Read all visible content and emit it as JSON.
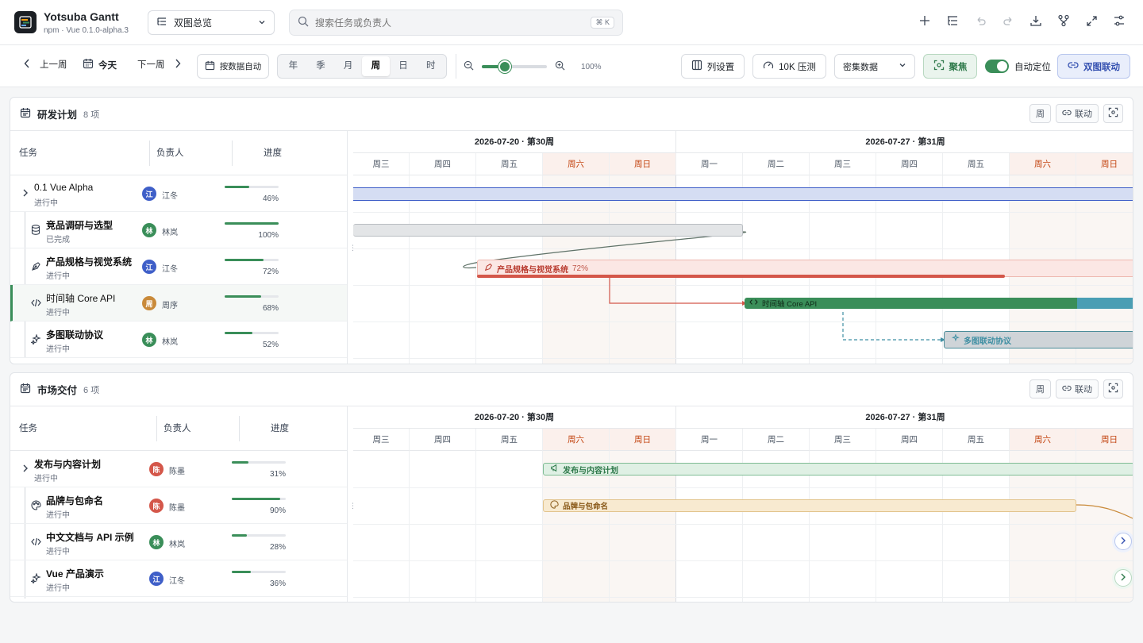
{
  "app": {
    "name": "Yotsuba Gantt",
    "version": "npm · Vue 0.1.0-alpha.3"
  },
  "view_select": {
    "label": "双图总览"
  },
  "search": {
    "placeholder": "搜索任务或负责人",
    "shortcut": "⌘ K"
  },
  "toolbar": {
    "prev_week": "上一周",
    "today": "今天",
    "next_week": "下一周",
    "auto_fit": "按数据自动",
    "scales": [
      "年",
      "季",
      "月",
      "周",
      "日",
      "时"
    ],
    "active_scale": "周",
    "zoom_value": "100%",
    "zoom_level": 0.35,
    "columns": "列设置",
    "stress": "10K 压测",
    "dataset": "密集数据",
    "focus": "聚焦",
    "auto_locate": "自动定位",
    "linked": "双图联动"
  },
  "panels": [
    {
      "title": "研发计划",
      "count": "8 项",
      "buttons": {
        "week": "周",
        "link": "联动"
      },
      "columns": {
        "task": "任务",
        "owner": "负责人",
        "progress": "进度"
      },
      "timeline": {
        "week1": "2026-07-20 · 第30周",
        "week2": "2026-07-27 · 第31周",
        "days": [
          "周三",
          "周四",
          "周五",
          "周六",
          "周日",
          "周一",
          "周二",
          "周三",
          "周四",
          "周五",
          "周六",
          "周日"
        ]
      },
      "rows": [
        {
          "name": "0.1 Vue Alpha",
          "status": "进行中",
          "owner": "江冬",
          "avatar": "江",
          "progress": "46%",
          "pct": 46
        },
        {
          "name": "竞品调研与选型",
          "status": "已完成",
          "owner": "林岚",
          "avatar": "林",
          "progress": "100%",
          "pct": 100
        },
        {
          "name": "产品规格与视觉系统",
          "status": "进行中",
          "owner": "江冬",
          "avatar": "江",
          "progress": "72%",
          "pct": 72
        },
        {
          "name": "时间轴 Core API",
          "status": "进行中",
          "owner": "周序",
          "avatar": "周",
          "progress": "68%",
          "pct": 68
        },
        {
          "name": "多图联动协议",
          "status": "进行中",
          "owner": "林岚",
          "avatar": "林",
          "progress": "52%",
          "pct": 52
        }
      ],
      "bars": {
        "spec": "产品规格与视觉系统",
        "spec_pct": "72%",
        "core": "时间轴 Core API",
        "sync": "多图联动协议"
      }
    },
    {
      "title": "市场交付",
      "count": "6 项",
      "buttons": {
        "week": "周",
        "link": "联动"
      },
      "columns": {
        "task": "任务",
        "owner": "负责人",
        "progress": "进度"
      },
      "timeline": {
        "week1": "2026-07-20 · 第30周",
        "week2": "2026-07-27 · 第31周",
        "days": [
          "周三",
          "周四",
          "周五",
          "周六",
          "周日",
          "周一",
          "周二",
          "周三",
          "周四",
          "周五",
          "周六",
          "周日"
        ]
      },
      "rows": [
        {
          "name": "发布与内容计划",
          "status": "进行中",
          "owner": "陈墨",
          "avatar": "陈",
          "progress": "31%",
          "pct": 31
        },
        {
          "name": "品牌与包命名",
          "status": "进行中",
          "owner": "陈墨",
          "avatar": "陈",
          "progress": "90%",
          "pct": 90
        },
        {
          "name": "中文文档与 API 示例",
          "status": "进行中",
          "owner": "林岚",
          "avatar": "林",
          "progress": "28%",
          "pct": 28
        },
        {
          "name": "Vue 产品演示",
          "status": "进行中",
          "owner": "江冬",
          "avatar": "江",
          "progress": "36%",
          "pct": 36
        }
      ],
      "bars": {
        "launch": "发布与内容计划",
        "brand": "品牌与包命名"
      }
    }
  ],
  "colors": {
    "accent": "#3a8e59",
    "blue": "#3f5fc8",
    "red": "#d4574a",
    "teal": "#3f8fa3",
    "orange": "#c98a3a"
  }
}
